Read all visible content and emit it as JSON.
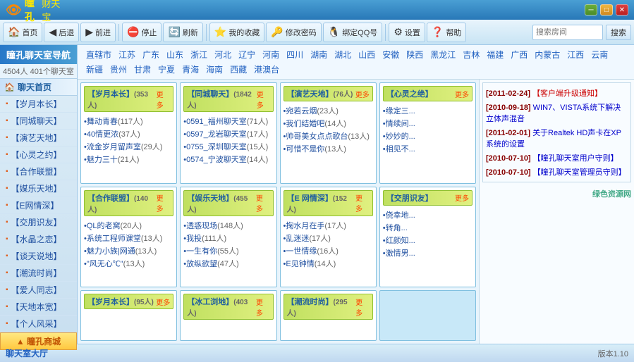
{
  "titlebar": {
    "logo": "瞳孔",
    "logo_sub": "财天宝",
    "min": "─",
    "max": "□",
    "close": "✕"
  },
  "toolbar": {
    "home": "首页",
    "back": "后退",
    "forward": "前进",
    "stop": "停止",
    "refresh": "刷新",
    "favorites": "我的收藏",
    "change_pwd": "修改密码",
    "bind_qq": "绑定QQ号",
    "settings": "设置",
    "help": "帮助",
    "search_placeholder": "搜索房间",
    "search_btn": "搜索"
  },
  "sidebar": {
    "title": "瞳孔聊天室导航",
    "count": "4504人  401个聊天室",
    "home_section": "聊天首页",
    "items": [
      "【岁月本长】",
      "【同城聊天】",
      "【演艺天地】",
      "【心灵之约】",
      "【合作联盟】",
      "【媒乐天地】",
      "【E网情深】",
      "【交朋识友】",
      "【水晶之恋】",
      "【谈天说地】",
      "【潮流时尚】",
      "【爱人同志】",
      "【天地本宽】",
      "【个人风采】"
    ],
    "shop": "▲ 瞳孔商城"
  },
  "regions": [
    "直辖市",
    "江苏",
    "广东",
    "山东",
    "浙江",
    "河北",
    "辽宁",
    "河南",
    "四川",
    "湖南",
    "湖北",
    "山西",
    "安徽",
    "陕西",
    "黑龙江",
    "吉林",
    "福建",
    "广西",
    "内蒙古",
    "江西",
    "云南",
    "新疆",
    "贵州",
    "甘肃",
    "宁夏",
    "青海",
    "海南",
    "西藏",
    "港澳台"
  ],
  "notices": [
    {
      "date": "[2011-02-24]",
      "text": "【客户端升级通知】",
      "red": true
    },
    {
      "date": "[2010-09-18]",
      "text": "WIN7、VISTA系统下解决立体声混音",
      "red": false
    },
    {
      "date": "[2011-02-01]",
      "text": "关于Realtek HD声卡在XP系统的设置",
      "red": false
    },
    {
      "date": "[2010-07-10]",
      "text": "【瞳孔聊天室用户守则】",
      "red": false
    },
    {
      "date": "[2010-07-10]",
      "text": "【瞳孔聊天室管理员守则】",
      "red": false
    }
  ],
  "room_cards": [
    {
      "title": "【岁月本长】",
      "count": "(353人)",
      "rooms": [
        {
          "name": "•舞动青春",
          "count": "(117人)"
        },
        {
          "name": "•40情更浓",
          "count": "(37人)"
        },
        {
          "name": "•流金岁月留声室",
          "count": "(29人)"
        },
        {
          "name": "•魅力三十",
          "count": "(21人)"
        }
      ]
    },
    {
      "title": "【同城聊天】",
      "count": "(1842人)",
      "rooms": [
        {
          "name": "•0591_福州聊天室",
          "count": "(71人)"
        },
        {
          "name": "•0597_龙岩聊天室",
          "count": "(17人)"
        },
        {
          "name": "•0755_深圳聊天室",
          "count": "(15人)"
        },
        {
          "name": "•0574_宁波聊天室",
          "count": "(14人)"
        }
      ]
    },
    {
      "title": "【演艺天地】",
      "count": "(76人)",
      "rooms": [
        {
          "name": "•宛若云烟",
          "count": "(23人)"
        },
        {
          "name": "•我们结婚吧",
          "count": "(14人)"
        },
        {
          "name": "•帅哥美女点点歌台",
          "count": "(13人)"
        },
        {
          "name": "•可惜不是你",
          "count": "(13人)"
        }
      ]
    },
    {
      "title": "【心灵之绝】",
      "count": "",
      "rooms": [
        {
          "name": "•缘定三...",
          "count": ""
        },
        {
          "name": "•情续间...",
          "count": ""
        },
        {
          "name": "•妙妙的...",
          "count": ""
        },
        {
          "name": "•相见不...",
          "count": ""
        }
      ]
    },
    {
      "title": "【合作联盟】",
      "count": "(140人)",
      "rooms": [
        {
          "name": "•QL的老窝",
          "count": "(20人)"
        },
        {
          "name": "•系统工程师课堂",
          "count": "(13人)"
        },
        {
          "name": "•魅力小族|网通",
          "count": "(13人)"
        },
        {
          "name": "•\"风无心℃\"",
          "count": "(13人)"
        }
      ]
    },
    {
      "title": "【娱乐天地】",
      "count": "(455人)",
      "rooms": [
        {
          "name": "•透惑现场",
          "count": "(148人)"
        },
        {
          "name": "•我投",
          "count": "(111人)"
        },
        {
          "name": "•一生有你",
          "count": "(55人)"
        },
        {
          "name": "•放纵欲望",
          "count": "(47人)"
        }
      ]
    },
    {
      "title": "【E 网情深】",
      "count": "(152人)",
      "rooms": [
        {
          "name": "•掬水月在手",
          "count": "(17人)"
        },
        {
          "name": "•乱迷迷",
          "count": "(17人)"
        },
        {
          "name": "•一世情缘",
          "count": "(16人)"
        },
        {
          "name": "•E见钟情",
          "count": "(14人)"
        }
      ]
    },
    {
      "title": "【交朋识友】",
      "count": "",
      "rooms": [
        {
          "name": "•侥幸地...",
          "count": ""
        },
        {
          "name": "•转角...",
          "count": ""
        },
        {
          "name": "•红颜知...",
          "count": ""
        },
        {
          "name": "•激情男...",
          "count": ""
        }
      ]
    }
  ],
  "bottom_row_cards": [
    {
      "title": "【岁月本长】",
      "count": "(95人)"
    },
    {
      "title": "【冰工浏地】",
      "count": "(403人)"
    },
    {
      "title": "【潮流时尚】",
      "count": "(295人)"
    }
  ],
  "bottom_bar": {
    "link": "聊天室大厅",
    "watermark": "绿色资源网",
    "version": "版本1.10"
  }
}
